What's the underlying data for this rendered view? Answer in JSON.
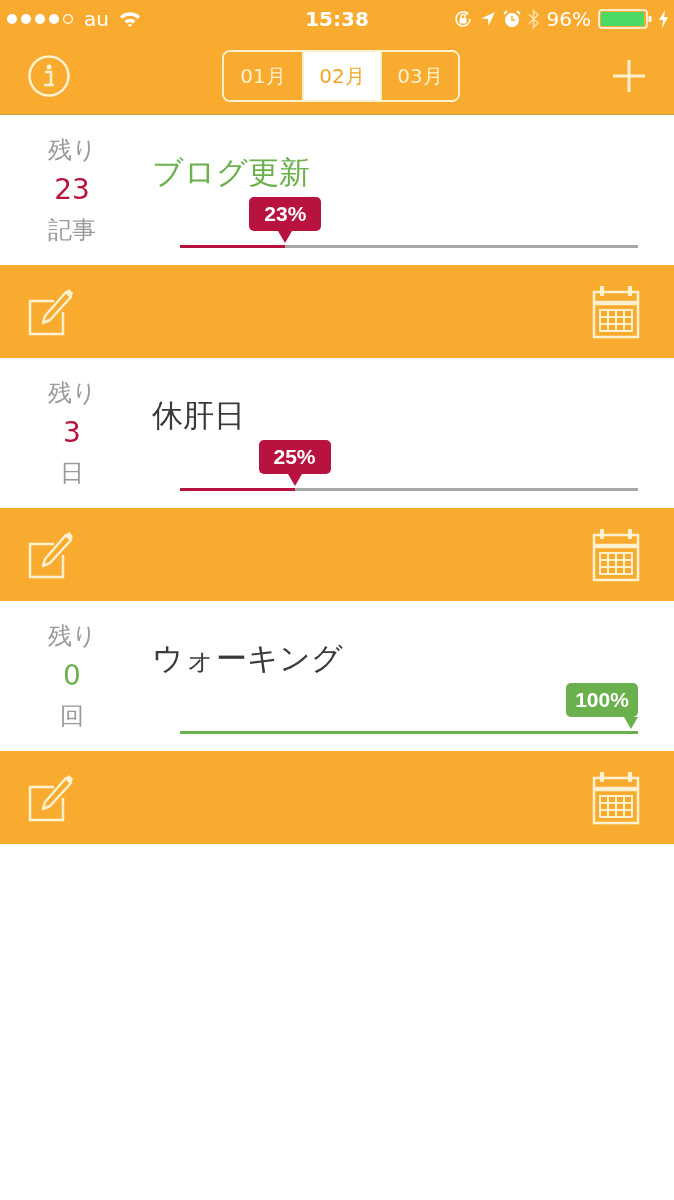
{
  "status_bar": {
    "carrier": "au",
    "time": "15:38",
    "battery_percent": "96%"
  },
  "nav": {
    "months": [
      {
        "label": "01月",
        "selected": false
      },
      {
        "label": "02月",
        "selected": true
      },
      {
        "label": "03月",
        "selected": false
      }
    ]
  },
  "goals": [
    {
      "remaining_label": "残り",
      "count": "23",
      "unit": "記事",
      "title": "ブログ更新",
      "highlighted": true,
      "level": 0.23,
      "percent": "23%",
      "color": "#b8123e"
    },
    {
      "remaining_label": "残り",
      "count": "3",
      "unit": "日",
      "title": "休肝日",
      "highlighted": false,
      "level": 0.25,
      "percent": "25%",
      "color": "#b8123e"
    },
    {
      "remaining_label": "残り",
      "count": "0",
      "unit": "回",
      "title": "ウォーキング",
      "highlighted": false,
      "level": 1,
      "percent": "100%",
      "color": "#6ab04c"
    }
  ]
}
